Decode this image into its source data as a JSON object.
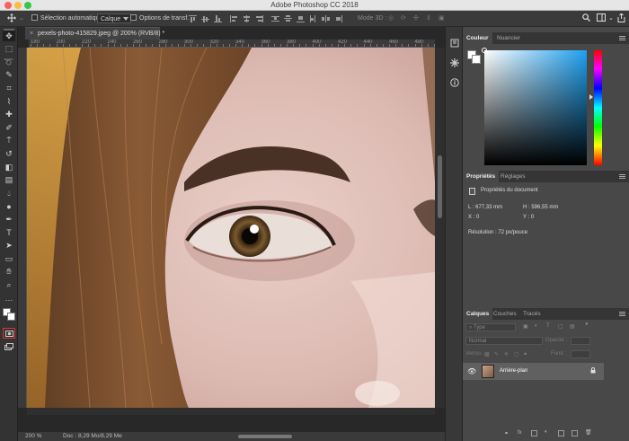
{
  "app": {
    "title": "Adobe Photoshop CC 2018",
    "traffic_colors": [
      "#fc605c",
      "#fdbc40",
      "#34c84a"
    ]
  },
  "options_bar": {
    "move_icon": "move-icon",
    "auto_select_label": "Sélection automatique :",
    "auto_select_value": "Calque",
    "transform_label": "Options de transf.",
    "mode3d_label": "Mode 3D :"
  },
  "document": {
    "tab_title": "pexels-photo-415829.jpeg @ 200% (RVB/8) *",
    "ruler_ticks": [
      "180",
      "200",
      "220",
      "240",
      "260",
      "280",
      "300",
      "320",
      "340",
      "360",
      "380",
      "400",
      "420",
      "440",
      "460",
      "480",
      "500"
    ],
    "zoom": "200 %",
    "doc_info": "Doc : 8,29 Mo/8,29 Mo"
  },
  "tools": [
    "move-icon",
    "marquee-icon",
    "lasso-icon",
    "quick-select-icon",
    "crop-icon",
    "eyedropper-icon",
    "healing-icon",
    "brush-icon",
    "clone-stamp-icon",
    "history-brush-icon",
    "eraser-icon",
    "gradient-icon",
    "blur-icon",
    "dodge-icon",
    "pen-icon",
    "type-icon",
    "path-select-icon",
    "rectangle-icon",
    "hand-icon",
    "zoom-icon",
    "more-icon"
  ],
  "color_panel": {
    "tabs": [
      "Couleur",
      "Nuancier"
    ],
    "hue_color": "#1ea0f0"
  },
  "properties_panel": {
    "tabs": [
      "Propriétés",
      "Réglages"
    ],
    "doc_props_label": "Propriétés du document",
    "width": "L : 677,33 mm",
    "height": "H : 596,55 mm",
    "x": "X : 0",
    "y": "Y : 0",
    "resolution": "Résolution : 72 px/pouce"
  },
  "layers_panel": {
    "tabs": [
      "Calques",
      "Couches",
      "Tracés"
    ],
    "filter_placeholder": "Type",
    "blend_mode": "Normal",
    "opacity_label": "Opacité :",
    "lock_label": "Verrou :",
    "fill_label": "Fond :",
    "layers": [
      {
        "name": "Arrière-plan",
        "visible": true,
        "locked": true
      }
    ]
  }
}
